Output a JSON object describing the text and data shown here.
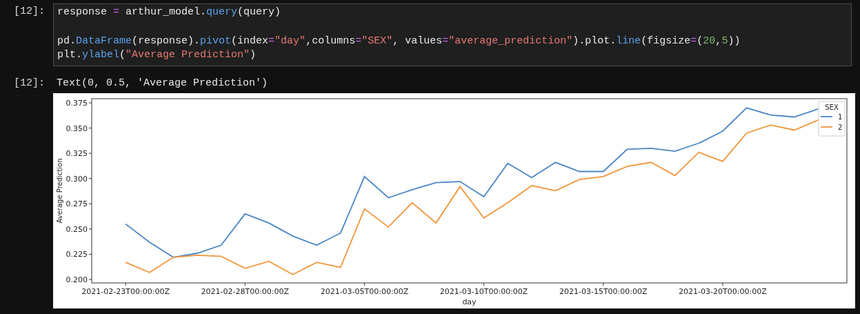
{
  "input_cell": {
    "prompt": "[12]:",
    "blocks": [
      {
        "lines": [
          [
            {
              "text": "response ",
              "kind": "plain"
            },
            {
              "text": "=",
              "kind": "op"
            },
            {
              "text": " arthur_model.",
              "kind": "plain"
            },
            {
              "text": "query",
              "kind": "func"
            },
            {
              "text": "(query)",
              "kind": "plain"
            }
          ]
        ]
      },
      {
        "lines": [
          [
            {
              "text": "pd.",
              "kind": "plain"
            },
            {
              "text": "DataFrame",
              "kind": "func"
            },
            {
              "text": "(response).",
              "kind": "plain"
            },
            {
              "text": "pivot",
              "kind": "func"
            },
            {
              "text": "(index",
              "kind": "plain"
            },
            {
              "text": "=",
              "kind": "op"
            },
            {
              "text": "\"day\"",
              "kind": "str"
            },
            {
              "text": ",columns",
              "kind": "plain"
            },
            {
              "text": "=",
              "kind": "op"
            },
            {
              "text": "\"SEX\"",
              "kind": "str"
            },
            {
              "text": ", values",
              "kind": "plain"
            },
            {
              "text": "=",
              "kind": "op"
            },
            {
              "text": "\"average_prediction\"",
              "kind": "str"
            },
            {
              "text": ").",
              "kind": "plain"
            },
            {
              "text": "plot",
              "kind": "plain"
            },
            {
              "text": ".",
              "kind": "plain"
            },
            {
              "text": "line",
              "kind": "func"
            },
            {
              "text": "(figsize",
              "kind": "plain"
            },
            {
              "text": "=",
              "kind": "op"
            },
            {
              "text": "(",
              "kind": "plain"
            },
            {
              "text": "20",
              "kind": "num"
            },
            {
              "text": ",",
              "kind": "plain"
            },
            {
              "text": "5",
              "kind": "num"
            },
            {
              "text": "))",
              "kind": "plain"
            }
          ],
          [
            {
              "text": "plt.",
              "kind": "plain"
            },
            {
              "text": "ylabel",
              "kind": "func"
            },
            {
              "text": "(",
              "kind": "plain"
            },
            {
              "text": "\"Average Prediction\"",
              "kind": "str"
            },
            {
              "text": ")",
              "kind": "plain"
            }
          ]
        ]
      }
    ]
  },
  "output_cell": {
    "prompt": "[12]:",
    "text": "Text(0, 0.5, 'Average Prediction')"
  },
  "figure": {
    "legend_title": "SEX",
    "chart_data": {
      "type": "line",
      "xlabel": "day",
      "ylabel": "Average Prediction",
      "categories": [
        "2021-02-23T00:00:00Z",
        null,
        null,
        null,
        null,
        "2021-02-28T00:00:00Z",
        null,
        null,
        null,
        null,
        "2021-03-05T00:00:00Z",
        null,
        null,
        null,
        null,
        "2021-03-10T00:00:00Z",
        null,
        null,
        null,
        null,
        "2021-03-15T00:00:00Z",
        null,
        null,
        null,
        null,
        "2021-03-20T00:00:00Z",
        null,
        null,
        null,
        null
      ],
      "legend": "upper right",
      "ylim": [
        0.1966,
        0.3791
      ],
      "yticks": [
        {
          "value": 0.2,
          "label": "0.200"
        },
        {
          "value": 0.225,
          "label": "0.225"
        },
        {
          "value": 0.25,
          "label": "0.250"
        },
        {
          "value": 0.275,
          "label": "0.275"
        },
        {
          "value": 0.3,
          "label": "0.300"
        },
        {
          "value": 0.325,
          "label": "0.325"
        },
        {
          "value": 0.35,
          "label": "0.350"
        },
        {
          "value": 0.375,
          "label": "0.375"
        }
      ],
      "series": [
        {
          "name": "1",
          "color": "#4a86c5",
          "values": [
            0.255,
            0.237,
            0.222,
            0.226,
            0.234,
            0.265,
            0.256,
            0.243,
            0.234,
            0.246,
            0.302,
            0.281,
            0.289,
            0.296,
            0.297,
            0.282,
            0.315,
            0.301,
            0.316,
            0.307,
            0.307,
            0.329,
            0.33,
            0.327,
            0.335,
            0.347,
            0.37,
            0.363,
            0.361,
            0.369
          ]
        },
        {
          "name": "2",
          "color": "#f0963a",
          "values": [
            0.217,
            0.207,
            0.222,
            0.224,
            0.223,
            0.211,
            0.218,
            0.205,
            0.217,
            0.212,
            0.27,
            0.252,
            0.276,
            0.256,
            0.292,
            0.261,
            0.276,
            0.293,
            0.288,
            0.299,
            0.302,
            0.312,
            0.316,
            0.303,
            0.326,
            0.317,
            0.345,
            0.353,
            0.348,
            0.358
          ]
        }
      ]
    }
  }
}
